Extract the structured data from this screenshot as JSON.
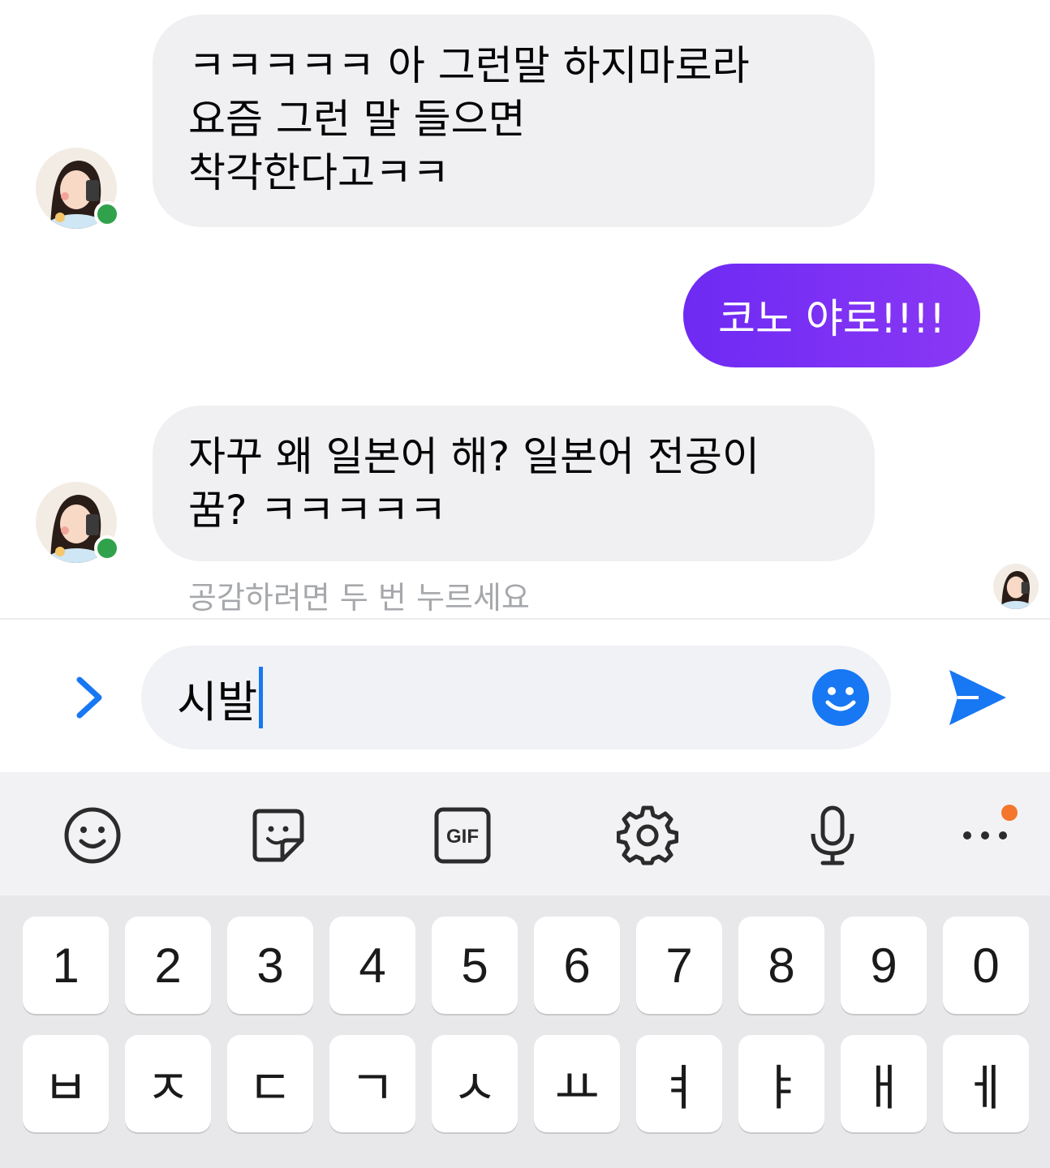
{
  "messages": [
    {
      "direction": "incoming",
      "text": "ㅋㅋㅋㅋㅋ 아 그런말 하지마로라\n요즘 그런 말 들으면\n착각한다고ㅋㅋ"
    },
    {
      "direction": "outgoing",
      "text": "코노 야로!!!!"
    },
    {
      "direction": "incoming",
      "text": "자꾸 왜 일본어 해? 일본어 전공이\n꿈? ㅋㅋㅋㅋㅋ"
    }
  ],
  "reaction_hint": "공감하려면 두 번 누르세요",
  "composer": {
    "input_value": "시발"
  },
  "keyboard": {
    "toolbar_icons": [
      "emoji-icon",
      "sticker-icon",
      "gif-icon",
      "settings-icon",
      "microphone-icon",
      "more-icon"
    ],
    "gif_label": "GIF",
    "number_row": [
      "1",
      "2",
      "3",
      "4",
      "5",
      "6",
      "7",
      "8",
      "9",
      "0"
    ],
    "letter_row": [
      "ㅂ",
      "ㅈ",
      "ㄷ",
      "ㄱ",
      "ㅅ",
      "ㅛ",
      "ㅕ",
      "ㅑ",
      "ㅐ",
      "ㅔ"
    ]
  },
  "colors": {
    "accent": "#1877f2",
    "outgoing_bubble": "#7b2ff7",
    "incoming_bubble": "#f0f0f2",
    "online": "#31a24c",
    "notification_dot": "#f4752c"
  }
}
